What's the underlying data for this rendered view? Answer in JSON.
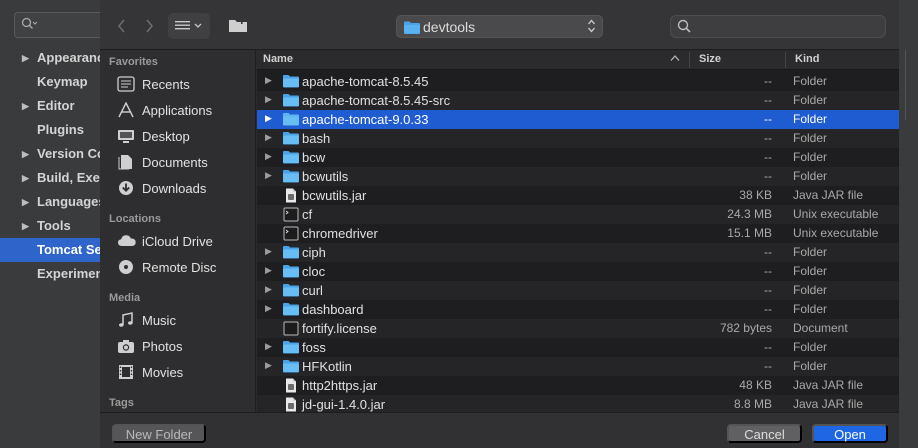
{
  "ide": {
    "tree": [
      {
        "label": "Appearance",
        "arrow": "▶",
        "selected": false
      },
      {
        "label": "Keymap",
        "arrow": "",
        "selected": false
      },
      {
        "label": "Editor",
        "arrow": "▶",
        "selected": false
      },
      {
        "label": "Plugins",
        "arrow": "",
        "selected": false
      },
      {
        "label": "Version Control",
        "arrow": "▶",
        "selected": false
      },
      {
        "label": "Build, Execution",
        "arrow": "▶",
        "selected": false
      },
      {
        "label": "Languages",
        "arrow": "▶",
        "selected": false
      },
      {
        "label": "Tools",
        "arrow": "▶",
        "selected": false
      },
      {
        "label": "Tomcat Server",
        "arrow": "",
        "selected": true
      },
      {
        "label": "Experimental",
        "arrow": "",
        "selected": false
      }
    ]
  },
  "dialog": {
    "path_label": "devtools",
    "search_placeholder": "",
    "sidebar": {
      "sections": [
        {
          "heading": "Favorites",
          "items": [
            {
              "label": "Recents",
              "icon": "recents-icon"
            },
            {
              "label": "Applications",
              "icon": "applications-icon"
            },
            {
              "label": "Desktop",
              "icon": "desktop-icon"
            },
            {
              "label": "Documents",
              "icon": "documents-icon"
            },
            {
              "label": "Downloads",
              "icon": "downloads-icon"
            }
          ]
        },
        {
          "heading": "Locations",
          "items": [
            {
              "label": "iCloud Drive",
              "icon": "icloud-icon"
            },
            {
              "label": "Remote Disc",
              "icon": "disc-icon"
            }
          ]
        },
        {
          "heading": "Media",
          "items": [
            {
              "label": "Music",
              "icon": "music-icon"
            },
            {
              "label": "Photos",
              "icon": "camera-icon"
            },
            {
              "label": "Movies",
              "icon": "film-icon"
            }
          ]
        },
        {
          "heading": "Tags",
          "items": []
        }
      ]
    },
    "columns": {
      "name": "Name",
      "size": "Size",
      "kind": "Kind"
    },
    "files": [
      {
        "name": "apache-tomcat-8.5.45",
        "size": "--",
        "kind": "Folder",
        "type": "folder",
        "selected": false
      },
      {
        "name": "apache-tomcat-8.5.45-src",
        "size": "--",
        "kind": "Folder",
        "type": "folder",
        "selected": false
      },
      {
        "name": "apache-tomcat-9.0.33",
        "size": "--",
        "kind": "Folder",
        "type": "folder",
        "selected": true
      },
      {
        "name": "bash",
        "size": "--",
        "kind": "Folder",
        "type": "folder",
        "selected": false
      },
      {
        "name": "bcw",
        "size": "--",
        "kind": "Folder",
        "type": "folder",
        "selected": false
      },
      {
        "name": "bcwutils",
        "size": "--",
        "kind": "Folder",
        "type": "folder",
        "selected": false
      },
      {
        "name": "bcwutils.jar",
        "size": "38 KB",
        "kind": "Java JAR file",
        "type": "jar",
        "selected": false
      },
      {
        "name": "cf",
        "size": "24.3 MB",
        "kind": "Unix executable",
        "type": "exec",
        "selected": false
      },
      {
        "name": "chromedriver",
        "size": "15.1 MB",
        "kind": "Unix executable",
        "type": "exec",
        "selected": false
      },
      {
        "name": "ciph",
        "size": "--",
        "kind": "Folder",
        "type": "folder",
        "selected": false
      },
      {
        "name": "cloc",
        "size": "--",
        "kind": "Folder",
        "type": "folder",
        "selected": false
      },
      {
        "name": "curl",
        "size": "--",
        "kind": "Folder",
        "type": "folder",
        "selected": false
      },
      {
        "name": "dashboard",
        "size": "--",
        "kind": "Folder",
        "type": "folder",
        "selected": false
      },
      {
        "name": "fortify.license",
        "size": "782 bytes",
        "kind": "Document",
        "type": "doc",
        "selected": false
      },
      {
        "name": "foss",
        "size": "--",
        "kind": "Folder",
        "type": "folder",
        "selected": false
      },
      {
        "name": "HFKotlin",
        "size": "--",
        "kind": "Folder",
        "type": "folder",
        "selected": false
      },
      {
        "name": "http2https.jar",
        "size": "48 KB",
        "kind": "Java JAR file",
        "type": "jar",
        "selected": false
      },
      {
        "name": "jd-gui-1.4.0.jar",
        "size": "8.8 MB",
        "kind": "Java JAR file",
        "type": "jar",
        "selected": false
      }
    ],
    "footer": {
      "new_folder_label": "New Folder",
      "cancel_label": "Cancel",
      "open_label": "Open"
    },
    "colors": {
      "selection": "#1f5bd1",
      "folder": "#4aa3e6",
      "accent": "#1e66e3"
    }
  }
}
